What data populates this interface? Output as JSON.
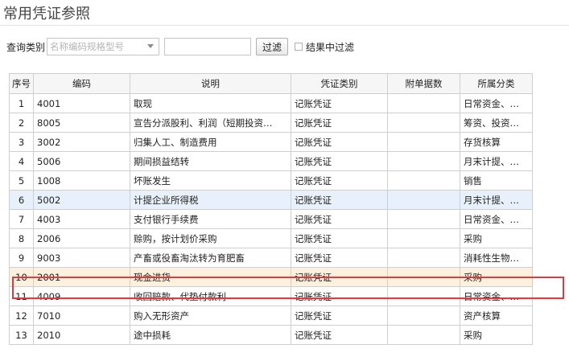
{
  "title": "常用凭证参照",
  "filter": {
    "label": "查询类别",
    "select_placeholder": "名称编码规格型号",
    "search_value": "",
    "button": "过滤",
    "checkbox_label": "结果中过滤"
  },
  "table": {
    "headers": [
      "序号",
      "编码",
      "说明",
      "凭证类别",
      "附单据数",
      "所属分类"
    ],
    "rows": [
      {
        "idx": "1",
        "code": "4001",
        "desc": "取现",
        "type": "记账凭证",
        "attach": "",
        "cat": "日常资金、…"
      },
      {
        "idx": "2",
        "code": "8005",
        "desc": "宣告分派股利、利润（短期投资…",
        "type": "记账凭证",
        "attach": "",
        "cat": "筹资、投资…"
      },
      {
        "idx": "3",
        "code": "3002",
        "desc": "归集人工、制造费用",
        "type": "记账凭证",
        "attach": "",
        "cat": "存货核算"
      },
      {
        "idx": "4",
        "code": "5006",
        "desc": "期间损益结转",
        "type": "记账凭证",
        "attach": "",
        "cat": "月末计提、…"
      },
      {
        "idx": "5",
        "code": "1008",
        "desc": "坏账发生",
        "type": "记账凭证",
        "attach": "",
        "cat": "销售"
      },
      {
        "idx": "6",
        "code": "5002",
        "desc": "计提企业所得税",
        "type": "记账凭证",
        "attach": "",
        "cat": "月末计提、…"
      },
      {
        "idx": "7",
        "code": "4003",
        "desc": "支付银行手续费",
        "type": "记账凭证",
        "attach": "",
        "cat": "日常资金、…"
      },
      {
        "idx": "8",
        "code": "2006",
        "desc": "赊购，按计划价采购",
        "type": "记账凭证",
        "attach": "",
        "cat": "采购"
      },
      {
        "idx": "9",
        "code": "9003",
        "desc": "产畜或役畜淘汰转为育肥畜",
        "type": "记账凭证",
        "attach": "",
        "cat": "消耗性生物…"
      },
      {
        "idx": "10",
        "code": "2001",
        "desc": "现金进货",
        "type": "记账凭证",
        "attach": "",
        "cat": "采购"
      },
      {
        "idx": "11",
        "code": "4009",
        "desc": "收回赔款、代垫付款利",
        "type": "记账凭证",
        "attach": "",
        "cat": "日常资金、…"
      },
      {
        "idx": "12",
        "code": "7010",
        "desc": "购入无形资产",
        "type": "记账凭证",
        "attach": "",
        "cat": "资产核算"
      },
      {
        "idx": "13",
        "code": "2010",
        "desc": "途中损耗",
        "type": "记账凭证",
        "attach": "",
        "cat": "采购"
      }
    ]
  },
  "colors": {
    "hover_row": "#e8f1fb",
    "selected_row": "#fdf0dc",
    "highlight_border": "#e0393e"
  }
}
